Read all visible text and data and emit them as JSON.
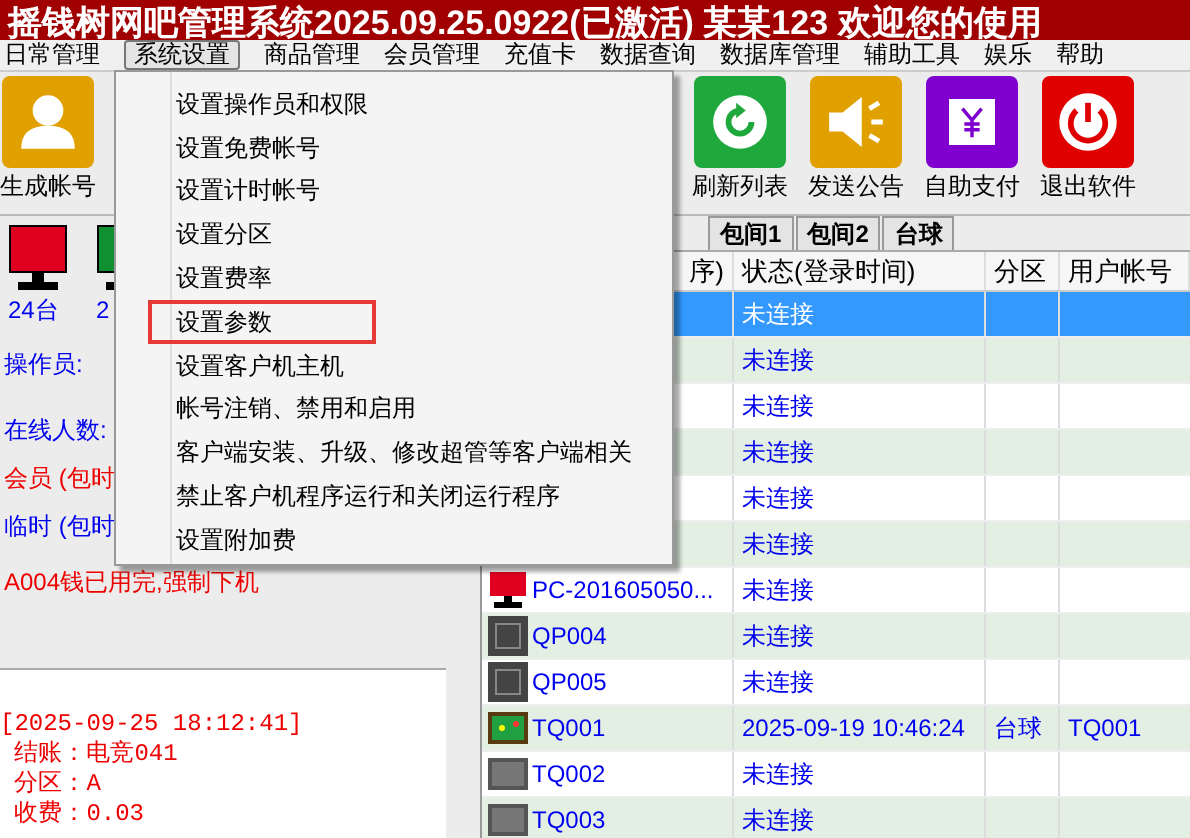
{
  "window": {
    "title": "摇钱树网吧管理系统2025.09.25.0922(已激活)  某某123 欢迎您的使用"
  },
  "menu_bar": [
    {
      "label": "日常管理",
      "selected": false
    },
    {
      "label": "系统设置",
      "selected": true
    },
    {
      "label": "商品管理",
      "selected": false
    },
    {
      "label": "会员管理",
      "selected": false
    },
    {
      "label": "充值卡",
      "selected": false
    },
    {
      "label": "数据查询",
      "selected": false
    },
    {
      "label": "数据库管理",
      "selected": false
    },
    {
      "label": "辅助工具",
      "selected": false
    },
    {
      "label": "娱乐",
      "selected": false
    },
    {
      "label": "帮助",
      "selected": false
    }
  ],
  "dropdown": [
    {
      "label": "设置操作员和权限",
      "highlighted": false
    },
    {
      "label": "设置免费帐号",
      "highlighted": false
    },
    {
      "label": "设置计时帐号",
      "highlighted": false
    },
    {
      "label": "设置分区",
      "highlighted": false
    },
    {
      "label": "设置费率",
      "highlighted": false
    },
    {
      "label": "设置参数",
      "highlighted": true
    },
    {
      "label": "设置客户机主机",
      "highlighted": false
    },
    {
      "label": "帐号注销、禁用和启用",
      "highlighted": false
    },
    {
      "label": "客户端安装、升级、修改超管等客户端相关",
      "highlighted": false
    },
    {
      "label": "禁止客户机程序运行和关闭运行程序",
      "highlighted": false
    },
    {
      "label": "设置附加费",
      "highlighted": false
    }
  ],
  "toolbar_left": [
    {
      "label": "生成帐号",
      "kind": "user"
    }
  ],
  "toolbar_right": [
    {
      "label": "刷新列表",
      "kind": "refresh"
    },
    {
      "label": "发送公告",
      "kind": "announce"
    },
    {
      "label": "自助支付",
      "kind": "pay"
    },
    {
      "label": "退出软件",
      "kind": "exit"
    }
  ],
  "machine_counts": [
    {
      "label": "24台",
      "color": "#e00020"
    },
    {
      "label": "2",
      "color": "#109030"
    }
  ],
  "info_lines": [
    {
      "text": "操作员:",
      "color": "#0000ee"
    },
    {
      "text": "在线人数:",
      "color": "#0000ee"
    },
    {
      "text": "会员 (包时",
      "color": "#ee0000"
    },
    {
      "text": "临时 (包时",
      "color": "#0000ee"
    }
  ],
  "notice": "A004钱已用完,强制下机",
  "log": [
    "[2025-09-25 18:12:41]",
    " 结账：电竞041",
    " 分区：A",
    " 收费：0.03"
  ],
  "tabs": [
    {
      "label": "包间1",
      "selected": false
    },
    {
      "label": "包间2",
      "selected": false
    },
    {
      "label": "台球",
      "selected": false
    }
  ],
  "table": {
    "columns": [
      "序)",
      "状态(登录时间)",
      "分区",
      "用户帐号"
    ],
    "rows": [
      {
        "selected": true,
        "status": "未连接"
      },
      {
        "selected": false,
        "status": "未连接"
      },
      {
        "selected": false,
        "status": "未连接"
      },
      {
        "selected": false,
        "status": "未连接"
      },
      {
        "selected": false,
        "status": "未连接"
      },
      {
        "selected": false,
        "status": "未连接"
      },
      {
        "selected": false,
        "kind": "pc",
        "name": "PC-201605050...",
        "status": "未连接"
      },
      {
        "selected": false,
        "kind": "console",
        "name": "QP004",
        "status": "未连接"
      },
      {
        "selected": false,
        "kind": "console",
        "name": "QP005",
        "status": "未连接"
      },
      {
        "selected": false,
        "kind": "billiard",
        "name": "TQ001",
        "status": "2025-09-19 10:46:24",
        "zone": "台球",
        "account": "TQ001"
      },
      {
        "selected": false,
        "kind": "billiard_off",
        "name": "TQ002",
        "status": "未连接"
      },
      {
        "selected": false,
        "kind": "billiard_off",
        "name": "TQ003",
        "status": "未连接"
      }
    ]
  }
}
